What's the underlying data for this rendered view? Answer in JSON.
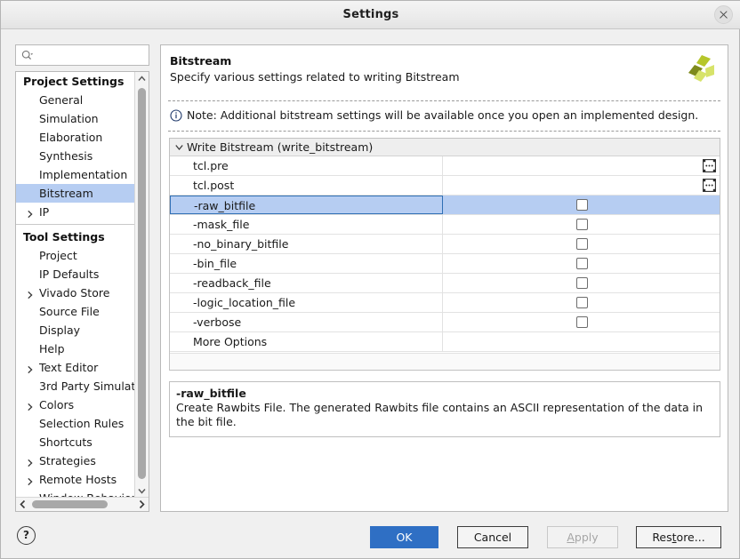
{
  "window": {
    "title": "Settings",
    "close_icon": "close-icon"
  },
  "search": {
    "icon": "search-icon",
    "value": "",
    "placeholder": ""
  },
  "sidebar": {
    "groups": [
      {
        "label": "Project Settings",
        "items": [
          {
            "label": "General",
            "expandable": false,
            "selected": false
          },
          {
            "label": "Simulation",
            "expandable": false,
            "selected": false
          },
          {
            "label": "Elaboration",
            "expandable": false,
            "selected": false
          },
          {
            "label": "Synthesis",
            "expandable": false,
            "selected": false
          },
          {
            "label": "Implementation",
            "expandable": false,
            "selected": false
          },
          {
            "label": "Bitstream",
            "expandable": false,
            "selected": true
          },
          {
            "label": "IP",
            "expandable": true,
            "selected": false
          }
        ]
      },
      {
        "label": "Tool Settings",
        "items": [
          {
            "label": "Project",
            "expandable": false,
            "selected": false
          },
          {
            "label": "IP Defaults",
            "expandable": false,
            "selected": false
          },
          {
            "label": "Vivado Store",
            "expandable": true,
            "selected": false
          },
          {
            "label": "Source File",
            "expandable": false,
            "selected": false
          },
          {
            "label": "Display",
            "expandable": false,
            "selected": false
          },
          {
            "label": "Help",
            "expandable": false,
            "selected": false
          },
          {
            "label": "Text Editor",
            "expandable": true,
            "selected": false
          },
          {
            "label": "3rd Party Simulat",
            "expandable": false,
            "selected": false
          },
          {
            "label": "Colors",
            "expandable": true,
            "selected": false
          },
          {
            "label": "Selection Rules",
            "expandable": false,
            "selected": false
          },
          {
            "label": "Shortcuts",
            "expandable": false,
            "selected": false
          },
          {
            "label": "Strategies",
            "expandable": true,
            "selected": false
          },
          {
            "label": "Remote Hosts",
            "expandable": true,
            "selected": false
          },
          {
            "label": "Window Behavior",
            "expandable": true,
            "selected": false
          }
        ]
      }
    ]
  },
  "page": {
    "title": "Bitstream",
    "subtitle": "Specify various settings related to writing Bitstream",
    "logo": "vivado-logo",
    "note_icon": "info-icon",
    "note": "Note: Additional bitstream settings will be available once you open an implemented design."
  },
  "table": {
    "group_label": "Write Bitstream (write_bitstream)",
    "rows": [
      {
        "name": "tcl.pre",
        "control": "browse",
        "checked": false,
        "selected": false
      },
      {
        "name": "tcl.post",
        "control": "browse",
        "checked": false,
        "selected": false
      },
      {
        "name": "-raw_bitfile",
        "control": "checkbox",
        "checked": false,
        "selected": true
      },
      {
        "name": "-mask_file",
        "control": "checkbox",
        "checked": false,
        "selected": false
      },
      {
        "name": "-no_binary_bitfile",
        "control": "checkbox",
        "checked": false,
        "selected": false
      },
      {
        "name": "-bin_file",
        "control": "checkbox",
        "checked": false,
        "selected": false
      },
      {
        "name": "-readback_file",
        "control": "checkbox",
        "checked": false,
        "selected": false
      },
      {
        "name": "-logic_location_file",
        "control": "checkbox",
        "checked": false,
        "selected": false
      },
      {
        "name": "-verbose",
        "control": "checkbox",
        "checked": false,
        "selected": false
      },
      {
        "name": "More Options",
        "control": "none",
        "checked": false,
        "selected": false
      }
    ]
  },
  "description": {
    "title": "-raw_bitfile",
    "body": "Create Rawbits File.  The generated Rawbits file contains an ASCII representation of the data in the bit file."
  },
  "footer": {
    "help_label": "?",
    "ok_label": "OK",
    "cancel_label": "Cancel",
    "apply_label": "Apply",
    "apply_mnemonic": "A",
    "restore_label": "Restore...",
    "restore_mnemonic": "t"
  },
  "colors": {
    "accent": "#2f6fc4",
    "selection": "#b6cdf2",
    "selection_border": "#2f6fb5",
    "logo_dark": "#7e8a1c",
    "logo_mid": "#b6c62a",
    "logo_light": "#d7e36a"
  }
}
